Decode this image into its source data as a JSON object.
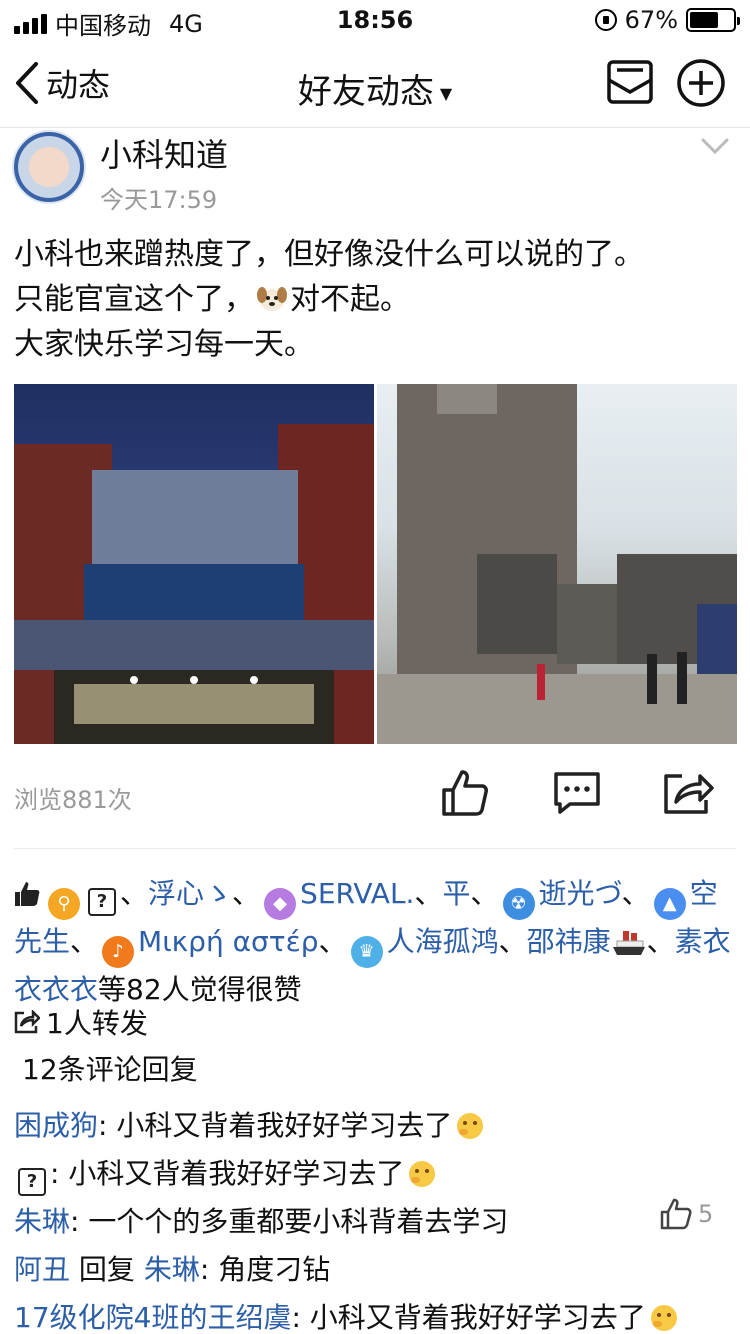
{
  "status": {
    "carrier": "中国移动",
    "network": "4G",
    "time": "18:56",
    "battery_text": "67%",
    "battery_level": 0.67
  },
  "nav": {
    "back_label": "动态",
    "title": "好友动态"
  },
  "post": {
    "author": "小科知道",
    "time": "今天17:59",
    "lines": [
      "小科也来蹭热度了，但好像没什么可以说的了。",
      "只能官宣这个了，",
      "对不起。",
      "大家快乐学习每一天。"
    ],
    "views": "浏览881次"
  },
  "likes": {
    "names": [
      "浮心ゝ",
      "SERVAL.",
      "平",
      "逝光づ",
      "空先生",
      "Μικρή αστέρ",
      "人海孤鸿",
      "邵祎康",
      "素衣衣衣衣"
    ],
    "sep": "、",
    "sep_plain": "、",
    "qmark": "?",
    "suffix": "等82人觉得很赞"
  },
  "forward": "1人转发",
  "comment_count": "12条评论回复",
  "comments": [
    {
      "name": "困成狗",
      "sep": ": ",
      "text": "小科又背着我好好学习去了"
    },
    {
      "name": "?",
      "sep": ": ",
      "text": "小科又背着我好好学习去了"
    },
    {
      "name": "朱琳",
      "sep": ": ",
      "text": "一个个的多重都要小科背着去学习",
      "likes": "5"
    },
    {
      "name": "阿丑",
      "reply_word": " 回复 ",
      "reply_to": "朱琳",
      "sep": ": ",
      "text": "角度刁钻"
    },
    {
      "name": "17级化院4班的王绍虞",
      "sep": ": ",
      "text": "小科又背着我好好学习去了"
    }
  ],
  "colors": {
    "link": "#2c5fa8",
    "muted": "#999999"
  }
}
